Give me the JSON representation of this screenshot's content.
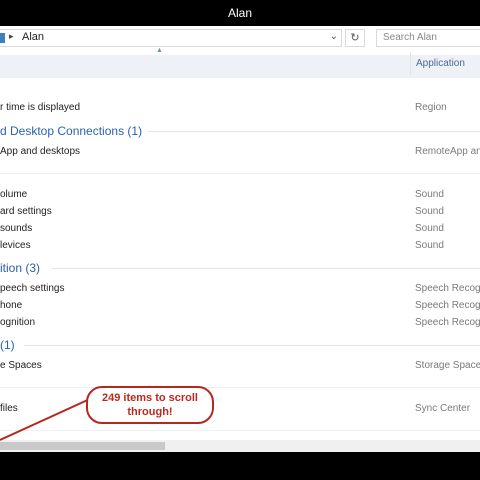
{
  "window": {
    "title": "Alan"
  },
  "address": {
    "path": "Alan",
    "separator": "▸",
    "chevron": "⌄",
    "refresh": "↻"
  },
  "search": {
    "placeholder": "Search Alan"
  },
  "columns": {
    "application": "Application"
  },
  "list": {
    "row1": {
      "name": "r time is displayed",
      "app": "Region"
    },
    "group1": "d Desktop Connections (1)",
    "row2": {
      "name": "App and desktops",
      "app": "RemoteApp and"
    },
    "row3": {
      "name": "olume",
      "app": "Sound"
    },
    "row4": {
      "name": "ard settings",
      "app": "Sound"
    },
    "row5": {
      "name": "sounds",
      "app": "Sound"
    },
    "row6": {
      "name": "levices",
      "app": "Sound"
    },
    "group2": "ition (3)",
    "row7": {
      "name": "peech settings",
      "app": "Speech Recogn"
    },
    "row8": {
      "name": "hone",
      "app": "Speech Recogn"
    },
    "row9": {
      "name": "ognition",
      "app": "Speech Recogn"
    },
    "group3": "(1)",
    "row10": {
      "name": "e Spaces",
      "app": "Storage Spaces"
    },
    "row11": {
      "name": "files",
      "app": "Sync Center"
    }
  },
  "callout": {
    "line1": "249 items to scroll",
    "line2": "through!"
  },
  "colors": {
    "callout": "#b4281f",
    "group_header": "#2c62a8"
  }
}
